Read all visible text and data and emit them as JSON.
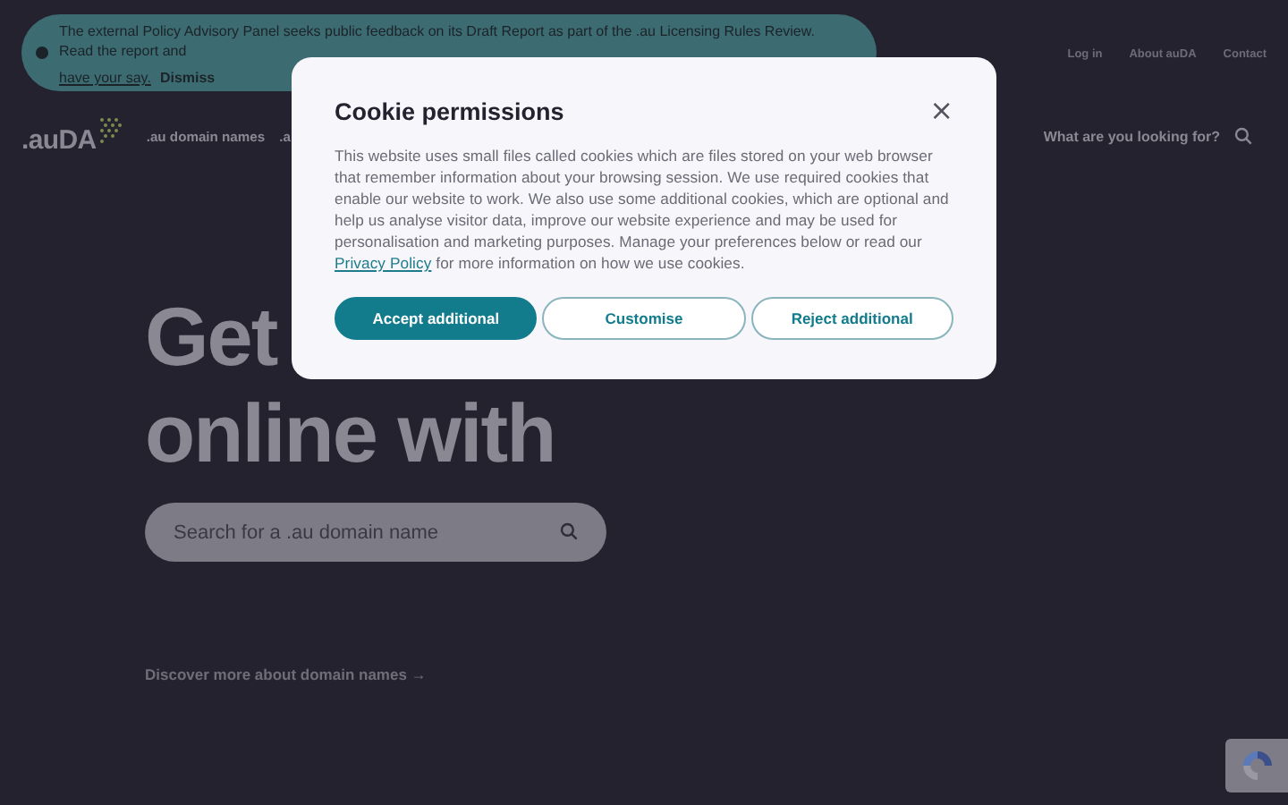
{
  "banner": {
    "message": "The external Policy Advisory Panel seeks public feedback on its Draft Report as part of the .au Licensing Rules Review. Read the report and",
    "link": "have your say.",
    "dismiss": "Dismiss"
  },
  "top_links": [
    "Log in",
    "About auDA",
    "Contact"
  ],
  "logo": {
    "text": ".auDA"
  },
  "nav": [
    ".au domain names",
    ".a"
  ],
  "site_search": {
    "label": "What are you looking for?"
  },
  "hero": {
    "lines": [
      "Get",
      "online with"
    ],
    "search": {
      "placeholder": "Search for a .au domain name"
    },
    "link": "Discover more about domain names →"
  },
  "cookie_dialog": {
    "title": "Cookie permissions",
    "close": "×",
    "text_before": "This website uses small files called cookies which are files stored on your web browser that remember information about your browsing session. We use required cookies that enable our website to work. We also use some additional cookies, which are optional and help us analyse visitor data, improve our website experience and may be used for personalisation and marketing purposes. Manage your preferences below or read our",
    "link": "Privacy Policy",
    "text_after": "for more information on how we use cookies.",
    "buttons": [
      {
        "label": "Accept additional",
        "kind": "primary"
      },
      {
        "label": "Customise",
        "kind": "outline"
      },
      {
        "label": "Reject additional",
        "kind": "outline"
      }
    ]
  }
}
